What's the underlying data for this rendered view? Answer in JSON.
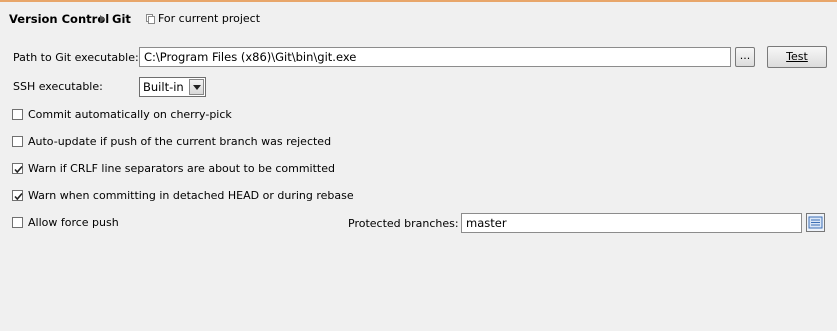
{
  "breadcrumb": {
    "root": "Version Control",
    "current": "Git"
  },
  "scope_label": "For current project",
  "git_path": {
    "label": "Path to Git executable:",
    "value": "C:\\Program Files (x86)\\Git\\bin\\git.exe",
    "browse_label": "...",
    "test_label": "Test"
  },
  "ssh": {
    "label": "SSH executable:",
    "selected": "Built-in"
  },
  "options": [
    {
      "label": "Commit automatically on cherry-pick",
      "checked": false
    },
    {
      "label": "Auto-update if push of the current branch was rejected",
      "checked": false
    },
    {
      "label": "Warn if CRLF line separators are about to be committed",
      "checked": true
    },
    {
      "label": "Warn when committing in detached HEAD or during rebase",
      "checked": true
    },
    {
      "label": "Allow force push",
      "checked": false
    }
  ],
  "protected_branches": {
    "label": "Protected branches:",
    "value": "master"
  },
  "colors": {
    "accent_line": "#e8a66a",
    "background": "#f0f0f0"
  }
}
